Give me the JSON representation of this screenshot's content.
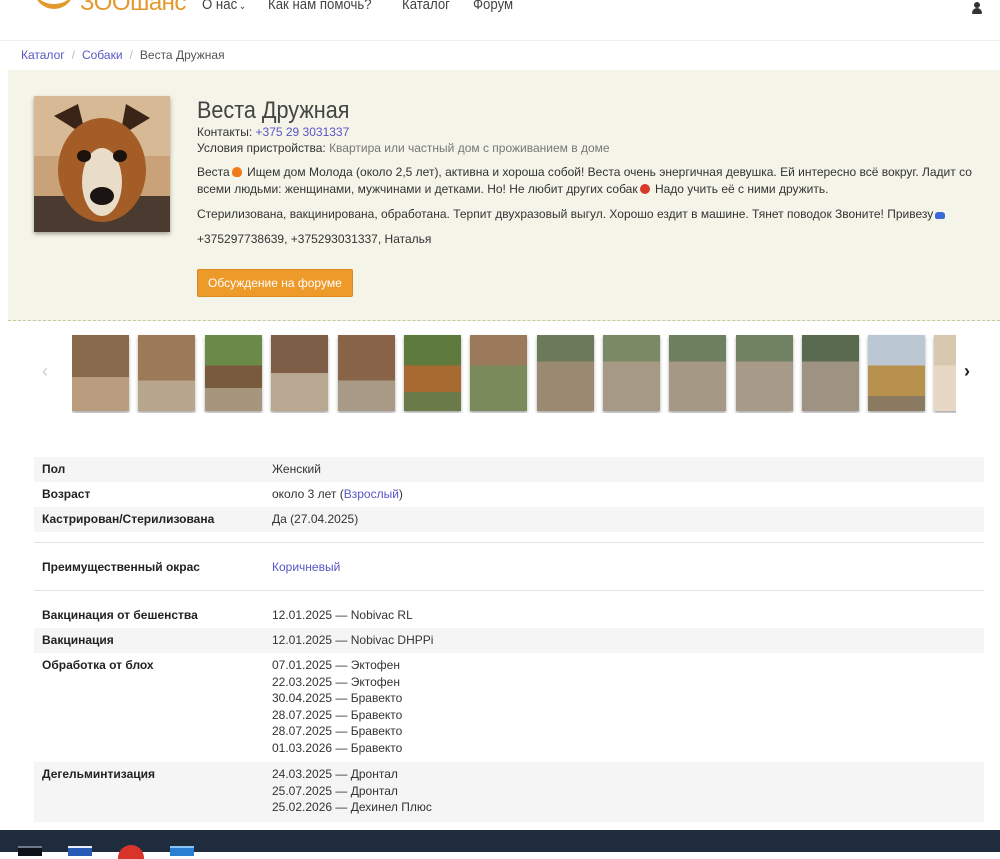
{
  "nav": {
    "logo_text": "ЗООшанс",
    "menu": [
      {
        "label": "О нас",
        "has_dropdown": true
      },
      {
        "label": "Как нам помочь?",
        "has_dropdown": false
      },
      {
        "label": "Каталог",
        "has_dropdown": false
      },
      {
        "label": "Форум",
        "has_dropdown": false
      }
    ],
    "user_icon": "user-icon"
  },
  "breadcrumb": {
    "items": [
      "Каталог",
      "Собаки"
    ],
    "current": "Веста Дружная"
  },
  "pet": {
    "name": "Веста Дружная",
    "contacts_label": "Контакты:",
    "contacts_value": "+375 29 3031337",
    "conditions_label": "Условия пристройства:",
    "conditions_value": "Квартира или частный дом с проживанием в доме",
    "desc_p1_a": "Веста",
    "desc_p1_b": "Ищем дом Молода (около 2,5 лет), активна и хороша собой! Веста очень энергичная девушка. Ей интересно всё вокруг. Ладит со всеми людьми: женщинами, мужчинами и детками. Но! Не любит других собак",
    "desc_p1_c": "Надо учить её с ними дружить.",
    "desc_p2": "Стерилизована, вакцинирована, обработана. Терпит двухразовый выгул. Хорошо ездит в машине. Тянет поводок Звоните! Привезу",
    "desc_p3": "+375297738639, +375293031337, Наталья",
    "forum_button": "Обсуждение на форуме"
  },
  "gallery": {
    "prev_icon": "chevron-left-icon",
    "next_icon": "chevron-right-icon",
    "thumb_count": 14
  },
  "details": {
    "sex_label": "Пол",
    "sex_value": "Женский",
    "age_label": "Возраст",
    "age_value": "около 3 лет (",
    "age_link": "Взрослый",
    "age_close": ")",
    "sterilized_label": "Кастрирован/Стерилизована",
    "sterilized_value": "Да (27.04.2025)",
    "color_label": "Преимущественный окрас",
    "color_value": "Коричневый",
    "rabies_label": "Вакцинация от бешенства",
    "rabies_value": "12.01.2025 — Nobivac RL",
    "vacc_label": "Вакцинация",
    "vacc_value": "12.01.2025 — Nobivac DHPPi",
    "flea_label": "Обработка от блох",
    "flea_values": [
      "07.01.2025 — Эктофен",
      "22.03.2025 — Эктофен",
      "30.04.2025 — Бравекто",
      "28.07.2025 — Бравекто",
      "28.07.2025 — Бравекто",
      "01.03.2026 — Бравекто"
    ],
    "worm_label": "Дегельминтизация",
    "worm_values": [
      "24.03.2025 — Дронтал",
      "25.07.2025 — Дронтал",
      "25.02.2026 — Дехинел Плюс"
    ]
  },
  "colors": {
    "accent": "#ee9a2a",
    "link": "#5a55c7",
    "hero_bg": "#f4f4e8",
    "taskbar": "#1f2c3e"
  }
}
